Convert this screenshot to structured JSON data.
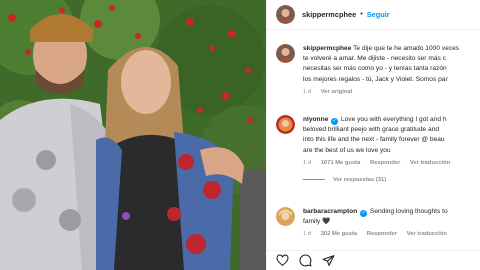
{
  "post": {
    "username": "skippermcphee",
    "follow_label": "Seguir",
    "caption_lines": [
      "Te dije que te he amado 1000 veces",
      "te volveré a amar. Me dijiste - necesito ser más c",
      "necesitas ser más como yo - y tenías tanta razón",
      "los mejores regalos - tú, Jack y Violet. Somos par"
    ],
    "caption_time": "1 d",
    "see_original": "Ver original"
  },
  "comments": [
    {
      "username": "nlyonne",
      "lines": [
        "Love you with everything I got and h",
        "beloved brilliant peejo with grace gratitude and",
        "into this life and the next - family forever @ beau",
        "are the best of us we love you"
      ],
      "time": "1 d",
      "likes": "1671 Me gusta",
      "reply": "Responder",
      "translate": "Ver traducción",
      "view_replies": "Ver respuestas (31)"
    },
    {
      "username": "barbaracrampton",
      "lines": [
        "Sending loving thoughts to",
        "family 🖤"
      ],
      "time": "1 d",
      "likes": "302 Me gusta",
      "reply": "Responder",
      "translate": "Ver traducción"
    }
  ],
  "icons": {
    "verified": "verified-badge-icon",
    "heart": "heart-icon",
    "comment": "comment-icon",
    "share": "share-icon",
    "like_action": "heart-outline-icon",
    "verified_glyph": "✓",
    "heart_glyph": "♡"
  },
  "colors": {
    "link": "#0095f6",
    "verified": "#0095f6",
    "muted": "#8e8e8e"
  }
}
